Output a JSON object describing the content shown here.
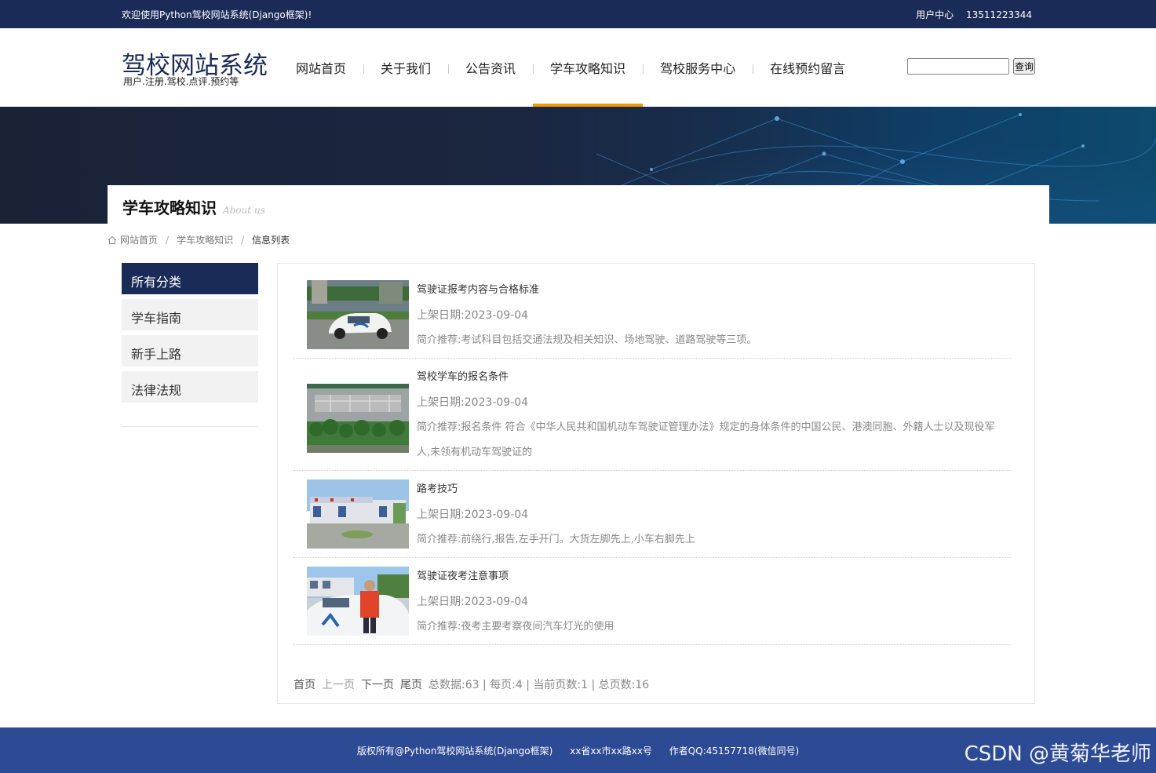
{
  "topbar": {
    "welcome": "欢迎使用Python驾校网站系统(Django框架)!",
    "user_center": "用户中心",
    "phone": "13511223344"
  },
  "header": {
    "logo_title": "驾校网站系统",
    "logo_sub": "用户.注册.驾校.点评.预约等",
    "nav": [
      {
        "label": "网站首页"
      },
      {
        "label": "关于我们"
      },
      {
        "label": "公告资讯"
      },
      {
        "label": "学车攻略知识",
        "active": true
      },
      {
        "label": "驾校服务中心"
      },
      {
        "label": "在线预约留言"
      }
    ],
    "search_value": "",
    "search_button": "查询"
  },
  "banner": {
    "title_cn": "学车攻略知识",
    "title_en": "About us"
  },
  "breadcrumb": {
    "home": "网站首页",
    "section": "学车攻略知识",
    "current": "信息列表"
  },
  "sidebar": {
    "heading": "所有分类",
    "items": [
      {
        "label": "学车指南"
      },
      {
        "label": "新手上路"
      },
      {
        "label": "法律法规"
      }
    ]
  },
  "list": {
    "date_label": "上架日期:",
    "desc_label": "简介推荐:",
    "items": [
      {
        "title": "驾驶证报考内容与合格标准",
        "date": "2023-09-04",
        "desc": "考试科目包括交通法规及相关知识、场地驾驶、道路驾驶等三项。",
        "thumb": "driving-car-photo"
      },
      {
        "title": "驾校学车的报名条件",
        "date": "2023-09-04",
        "desc": "报名条件 符合《中华人民共和国机动车驾驶证管理办法》规定的身体条件的中国公民、港澳同胞、外籍人士以及现役军人,未领有机动车驾驶证的",
        "thumb": "training-ground-aerial-photo"
      },
      {
        "title": "路考技巧",
        "date": "2023-09-04",
        "desc": "前绕行,报告,左手开门。大货左脚先上,小车右脚先上",
        "thumb": "driving-school-building-photo"
      },
      {
        "title": "驾驶证夜考注意事项",
        "date": "2023-09-04",
        "desc": "夜考主要考察夜间汽车灯光的使用",
        "thumb": "instructor-with-car-photo"
      }
    ]
  },
  "pager": {
    "first": "首页",
    "prev": "上一页",
    "next": "下一页",
    "last": "尾页",
    "stats": "总数据:63 | 每页:4 | 当前页数:1 | 总页数:16"
  },
  "footer": {
    "copyright": "版权所有@Python驾校网站系统(Django框架)",
    "address": "xx省xx市xx路xx号",
    "qq": "作者QQ:45157718(微信同号)"
  },
  "watermark": "CSDN @黄菊华老师",
  "colors": {
    "navy": "#1b2b58",
    "accent": "#f39800",
    "footer": "#2d4a94"
  }
}
